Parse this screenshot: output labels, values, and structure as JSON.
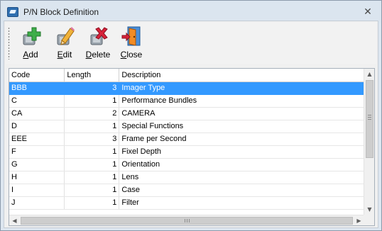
{
  "window": {
    "title": "P/N Block Definition",
    "close_glyph": "✕"
  },
  "toolbar": {
    "add_label": "Add",
    "add_mnemonic": "A",
    "add_rest": "dd",
    "edit_mnemonic": "E",
    "edit_rest": "dit",
    "delete_mnemonic": "D",
    "delete_rest": "elete",
    "close_mnemonic": "C",
    "close_rest": "lose",
    "icons": [
      "add-icon",
      "edit-icon",
      "delete-icon",
      "close-door-icon"
    ]
  },
  "grid": {
    "columns": [
      "Code",
      "Length",
      "Description"
    ],
    "selected_row": 0,
    "selection_color": "#3399ff",
    "rows": [
      {
        "code": "BBB",
        "length": "3",
        "description": "Imager Type"
      },
      {
        "code": "C",
        "length": "1",
        "description": "Performance Bundles"
      },
      {
        "code": "CA",
        "length": "2",
        "description": "CAMERA"
      },
      {
        "code": "D",
        "length": "1",
        "description": "Special Functions"
      },
      {
        "code": "EEE",
        "length": "3",
        "description": "Frame per Second"
      },
      {
        "code": "F",
        "length": "1",
        "description": "Fixel Depth"
      },
      {
        "code": "G",
        "length": "1",
        "description": "Orientation"
      },
      {
        "code": "H",
        "length": "1",
        "description": "Lens"
      },
      {
        "code": "I",
        "length": "1",
        "description": "Case"
      },
      {
        "code": "J",
        "length": "1",
        "description": "Filter"
      }
    ]
  }
}
